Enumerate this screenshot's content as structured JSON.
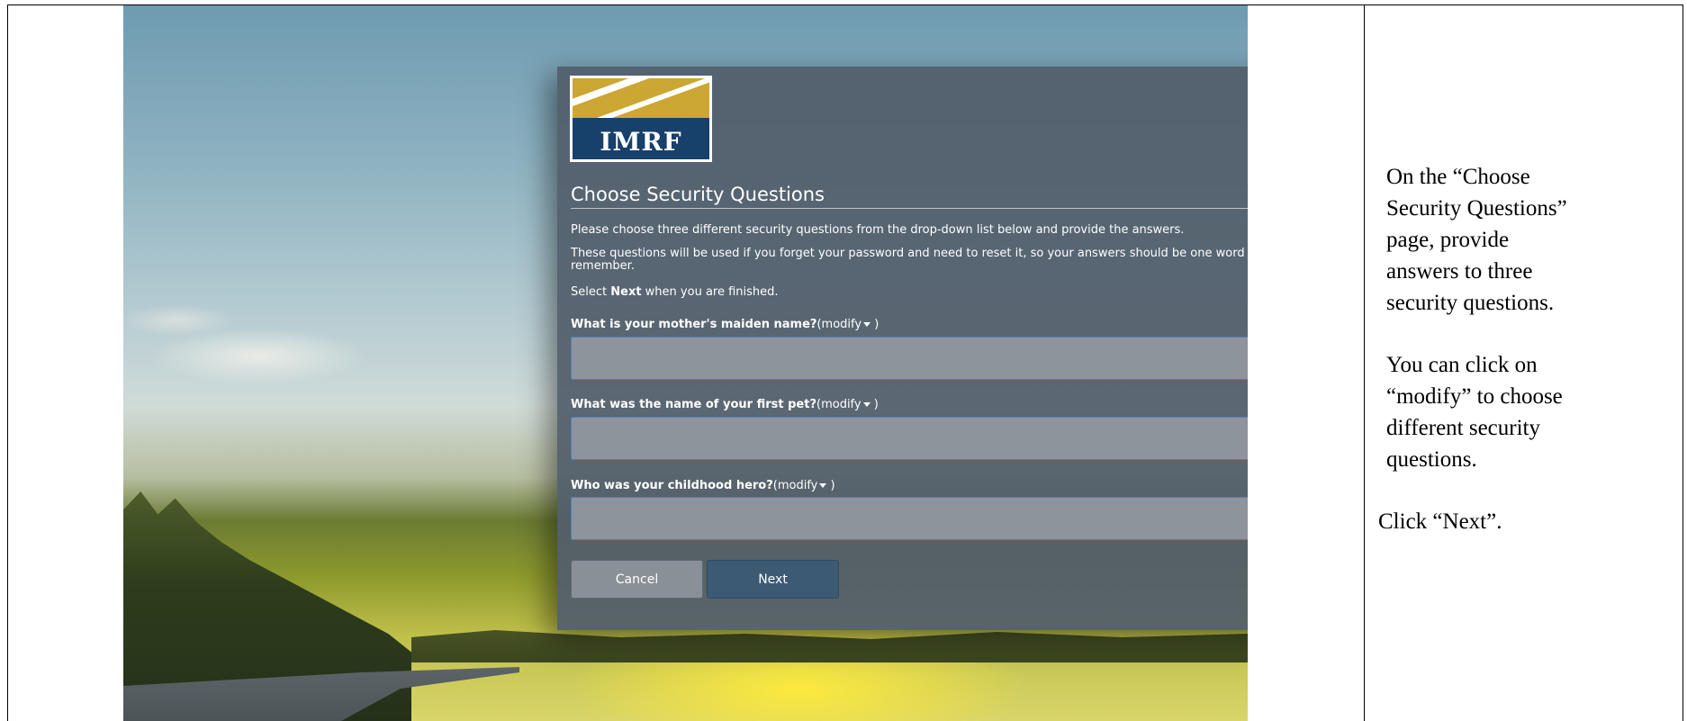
{
  "logo": {
    "text": "IMRF"
  },
  "dialog": {
    "title": "Choose Security Questions",
    "instruction_1": "Please choose three different security questions from the drop-down list below and provide the answers.",
    "instruction_2": "These questions will be used if you forget your password and need to reset it, so your answers should be one word and easy to remember.",
    "instruction_3_prefix": "Select ",
    "instruction_3_bold": "Next",
    "instruction_3_suffix": " when you are finished.",
    "questions": [
      {
        "label": "What is your mother's maiden name?",
        "modify": "(modify",
        "close": ")",
        "answer": ""
      },
      {
        "label": "What was the name of your first pet?",
        "modify": "(modify",
        "close": ")",
        "answer": ""
      },
      {
        "label": "Who was your childhood hero?",
        "modify": "(modify",
        "close": ")",
        "answer": ""
      }
    ],
    "cancel_label": "Cancel",
    "next_label": "Next"
  },
  "instructions": {
    "p1_lines": [
      "On the “Choose",
      "Security Questions”",
      "page, provide",
      "answers to three",
      "security questions."
    ],
    "p2_lines": [
      "You can click on",
      "“modify” to choose",
      "different security",
      "questions."
    ],
    "p3": "Click “Next”."
  },
  "colors": {
    "dialog_bg": "#525e6a",
    "input_bg": "#8e949c",
    "next_button": "#3d5a74",
    "logo_navy": "#17406b",
    "logo_gold": "#c9a227"
  }
}
